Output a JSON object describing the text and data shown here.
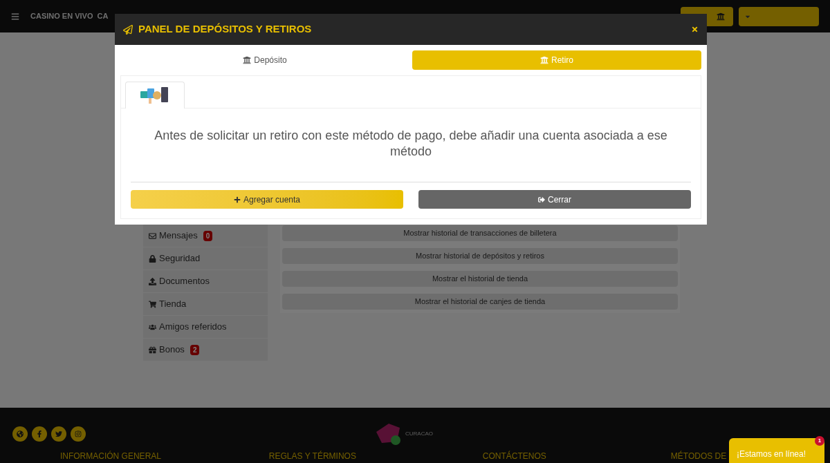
{
  "top_nav": {
    "links": [
      "CASINO EN VIVO",
      "CA"
    ]
  },
  "sidebar": {
    "items": [
      {
        "label": "Mensajes",
        "badge": "0"
      },
      {
        "label": "Seguridad"
      },
      {
        "label": "Documentos"
      },
      {
        "label": "Tienda"
      },
      {
        "label": "Amigos referidos"
      },
      {
        "label": "Bonos",
        "badge": "2"
      }
    ]
  },
  "history_buttons": [
    "Mostrar historial de transacciones de billetera",
    "Mostrar historial de depósitos y retiros",
    "Mostrar el historial de tienda",
    "Mostrar el historial de canjes de tienda"
  ],
  "footer": {
    "headings": [
      "INFORMACIÓN GENERAL",
      "REGLAS Y TÉRMINOS",
      "CONTÁCTENOS",
      "MÉTODOS DE"
    ],
    "license_label": "CURACAO"
  },
  "modal": {
    "title": "PANEL DE DEPÓSITOS Y RETIROS",
    "tabs": [
      {
        "label": "Depósito",
        "selected": false
      },
      {
        "label": "Retiro",
        "selected": true
      }
    ],
    "method_tabs": [
      {
        "selected": true
      }
    ],
    "message": "Antes de solicitar un retiro con este método de pago, debe añadir una cuenta asociada a ese método",
    "buttons": [
      {
        "label": "Agregar cuenta",
        "kind": "add"
      },
      {
        "label": "Cerrar",
        "kind": "close"
      }
    ]
  },
  "chat": {
    "label": "¡Estamos en línea!",
    "badge": "1"
  }
}
